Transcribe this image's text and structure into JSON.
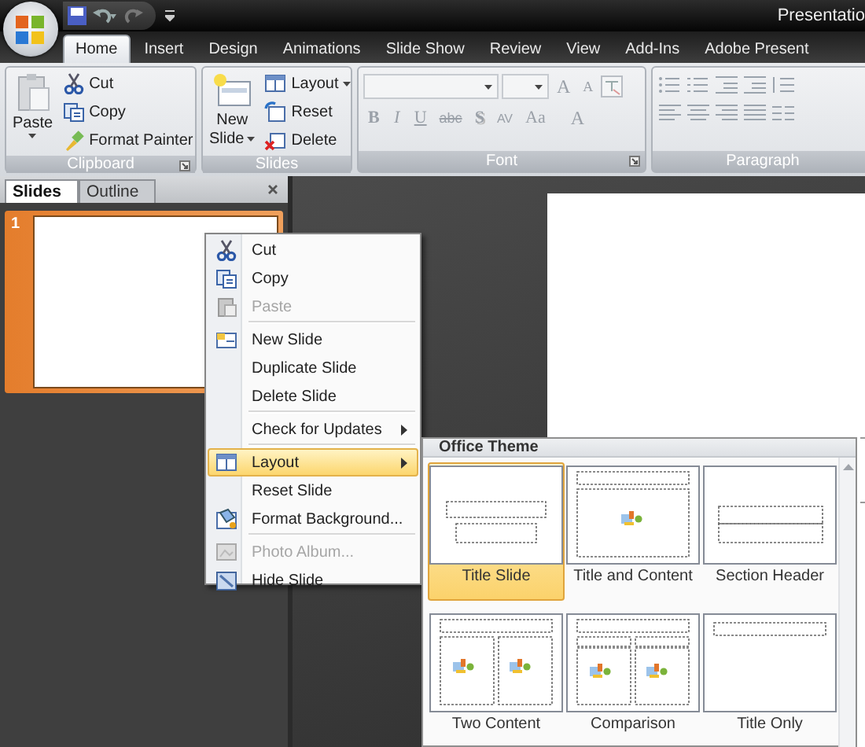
{
  "title_bar": {
    "title": "Presentatio"
  },
  "ribbon": {
    "tabs": [
      {
        "label": "Home",
        "selected": true
      },
      {
        "label": "Insert",
        "selected": false
      },
      {
        "label": "Design",
        "selected": false
      },
      {
        "label": "Animations",
        "selected": false
      },
      {
        "label": "Slide Show",
        "selected": false
      },
      {
        "label": "Review",
        "selected": false
      },
      {
        "label": "View",
        "selected": false
      },
      {
        "label": "Add-Ins",
        "selected": false
      },
      {
        "label": "Adobe Present",
        "selected": false
      }
    ],
    "clipboard": {
      "label": "Clipboard",
      "paste": "Paste",
      "commands": [
        {
          "label": "Cut"
        },
        {
          "label": "Copy"
        },
        {
          "label": "Format Painter"
        }
      ]
    },
    "slides": {
      "label": "Slides",
      "new_slide": [
        "New",
        "Slide"
      ],
      "commands": [
        {
          "label": "Layout",
          "dropdown": true
        },
        {
          "label": "Reset",
          "dropdown": false
        },
        {
          "label": "Delete",
          "dropdown": false
        }
      ]
    },
    "font": {
      "label": "Font",
      "disabled": true,
      "grow": "A",
      "shrink": "A",
      "color_button": "A",
      "buttons": [
        {
          "label": "B",
          "kind": "bold"
        },
        {
          "label": "I",
          "kind": "italic"
        },
        {
          "label": "U",
          "kind": "underline"
        },
        {
          "label": "abc",
          "kind": "strike"
        },
        {
          "label": "S",
          "kind": "shadow"
        },
        {
          "label": "AV",
          "kind": "spacing"
        },
        {
          "label": "Aa",
          "kind": "case"
        }
      ]
    },
    "paragraph": {
      "label": "Paragraph"
    }
  },
  "slides_pane": {
    "tabs": [
      {
        "label": "Slides",
        "selected": true
      },
      {
        "label": "Outline",
        "selected": false
      }
    ],
    "thumbnails": [
      {
        "number": "1",
        "selected": true
      }
    ]
  },
  "context_menu": {
    "items": [
      {
        "kind": "item",
        "label": "Cut",
        "disabled": false,
        "submenu": false,
        "selected": false
      },
      {
        "kind": "item",
        "label": "Copy",
        "disabled": false,
        "submenu": false,
        "selected": false
      },
      {
        "kind": "item",
        "label": "Paste",
        "disabled": true,
        "submenu": false,
        "selected": false
      },
      {
        "kind": "separator"
      },
      {
        "kind": "item",
        "label": "New Slide",
        "disabled": false,
        "submenu": false,
        "selected": false
      },
      {
        "kind": "item",
        "label": "Duplicate Slide",
        "disabled": false,
        "submenu": false,
        "selected": false
      },
      {
        "kind": "item",
        "label": "Delete Slide",
        "disabled": false,
        "submenu": false,
        "selected": false
      },
      {
        "kind": "separator"
      },
      {
        "kind": "item",
        "label": "Check for Updates",
        "disabled": false,
        "submenu": true,
        "selected": false
      },
      {
        "kind": "separator"
      },
      {
        "kind": "item",
        "label": "Layout",
        "disabled": false,
        "submenu": true,
        "selected": true
      },
      {
        "kind": "item",
        "label": "Reset Slide",
        "disabled": false,
        "submenu": false,
        "selected": false
      },
      {
        "kind": "item",
        "label": "Format Background...",
        "disabled": false,
        "submenu": false,
        "selected": false
      },
      {
        "kind": "separator"
      },
      {
        "kind": "item",
        "label": "Photo Album...",
        "disabled": true,
        "submenu": false,
        "selected": false
      },
      {
        "kind": "item",
        "label": "Hide Slide",
        "disabled": false,
        "submenu": false,
        "selected": false
      }
    ]
  },
  "layout_gallery": {
    "title": "Office Theme",
    "layouts": [
      {
        "label": "Title Slide",
        "kind": "title",
        "selected": true
      },
      {
        "label": "Title and Content",
        "kind": "title-content",
        "selected": false
      },
      {
        "label": "Section Header",
        "kind": "section",
        "selected": false
      },
      {
        "label": "Two Content",
        "kind": "two-content",
        "selected": false
      },
      {
        "label": "Comparison",
        "kind": "comparison",
        "selected": false
      },
      {
        "label": "Title Only",
        "kind": "title-only",
        "selected": false
      }
    ]
  }
}
